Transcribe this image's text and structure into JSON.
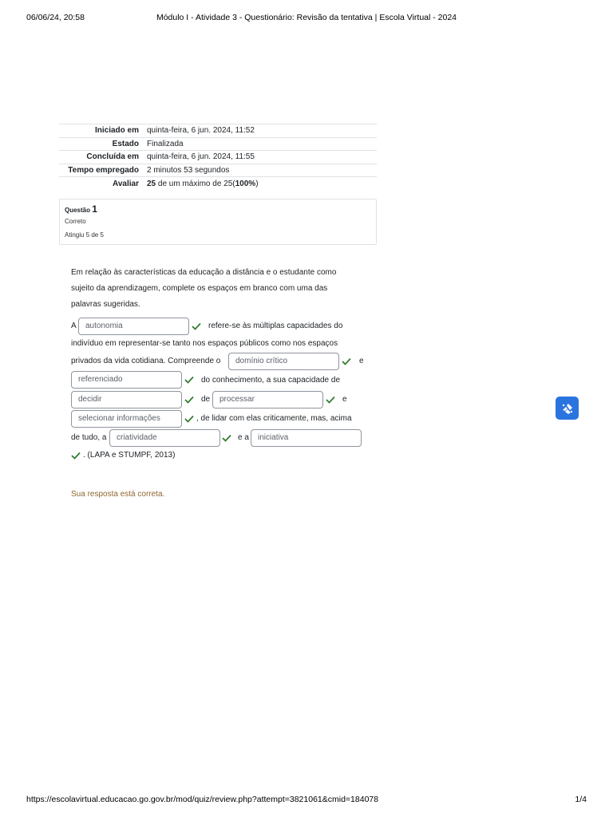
{
  "print_header": {
    "datetime": "06/06/24, 20:58",
    "page_title": "Módulo I - Atividade 3 - Questionário: Revisão da tentativa | Escola Virtual - 2024"
  },
  "summary": [
    {
      "label": "Iniciado em",
      "value": "quinta-feira, 6 jun. 2024, 11:52"
    },
    {
      "label": "Estado",
      "value": "Finalizada"
    },
    {
      "label": "Concluída em",
      "value": "quinta-feira, 6 jun. 2024, 11:55"
    },
    {
      "label": "Tempo empregado",
      "value": "2 minutos 53 segundos"
    },
    {
      "label": "Avaliar",
      "score": "25",
      "max_text": " de um máximo de 25(",
      "percent": "100%",
      "close": ")"
    }
  ],
  "question": {
    "label": "Questão",
    "number": "1",
    "state": "Correto",
    "grade": "Atingiu 5 de 5",
    "intro_lines": [
      "Em relação às características da educação a distância e o estudante como",
      "sujeito da aprendizagem, complete os espaços em branco com uma das",
      "palavras sugeridas."
    ],
    "text": {
      "a": "A",
      "refere": "refere-se às múltiplas capacidades do",
      "individuo": "indivíduo em representar-se tanto nos espaços públicos como nos espaços",
      "privados": "privados da vida cotidiana. Compreende o",
      "e1": "e",
      "conhecimento": "do conhecimento, a sua capacidade de",
      "de": "de",
      "e2": "e",
      "lidar": ", de lidar com elas criticamente, mas, acima",
      "detudo": "de tudo, a",
      "ea": "e a",
      "ref": ". (LAPA e STUMPF, 2013)"
    },
    "blanks": {
      "b1": "autonomia",
      "b2": "domínio crítico",
      "b3": "referenciado",
      "b4": "decidir",
      "b5": "processar",
      "b6": "selecionar informações",
      "b7": "criatividade",
      "b8": "iniciativa"
    },
    "feedback": "Sua resposta está correta."
  },
  "colors": {
    "tick": "#357a32",
    "feedback": "#8e662e",
    "accessibility_button": "#2a74e0"
  },
  "print_footer": {
    "url": "https://escolavirtual.educacao.go.gov.br/mod/quiz/review.php?attempt=3821061&cmid=184078",
    "page": "1/4"
  }
}
